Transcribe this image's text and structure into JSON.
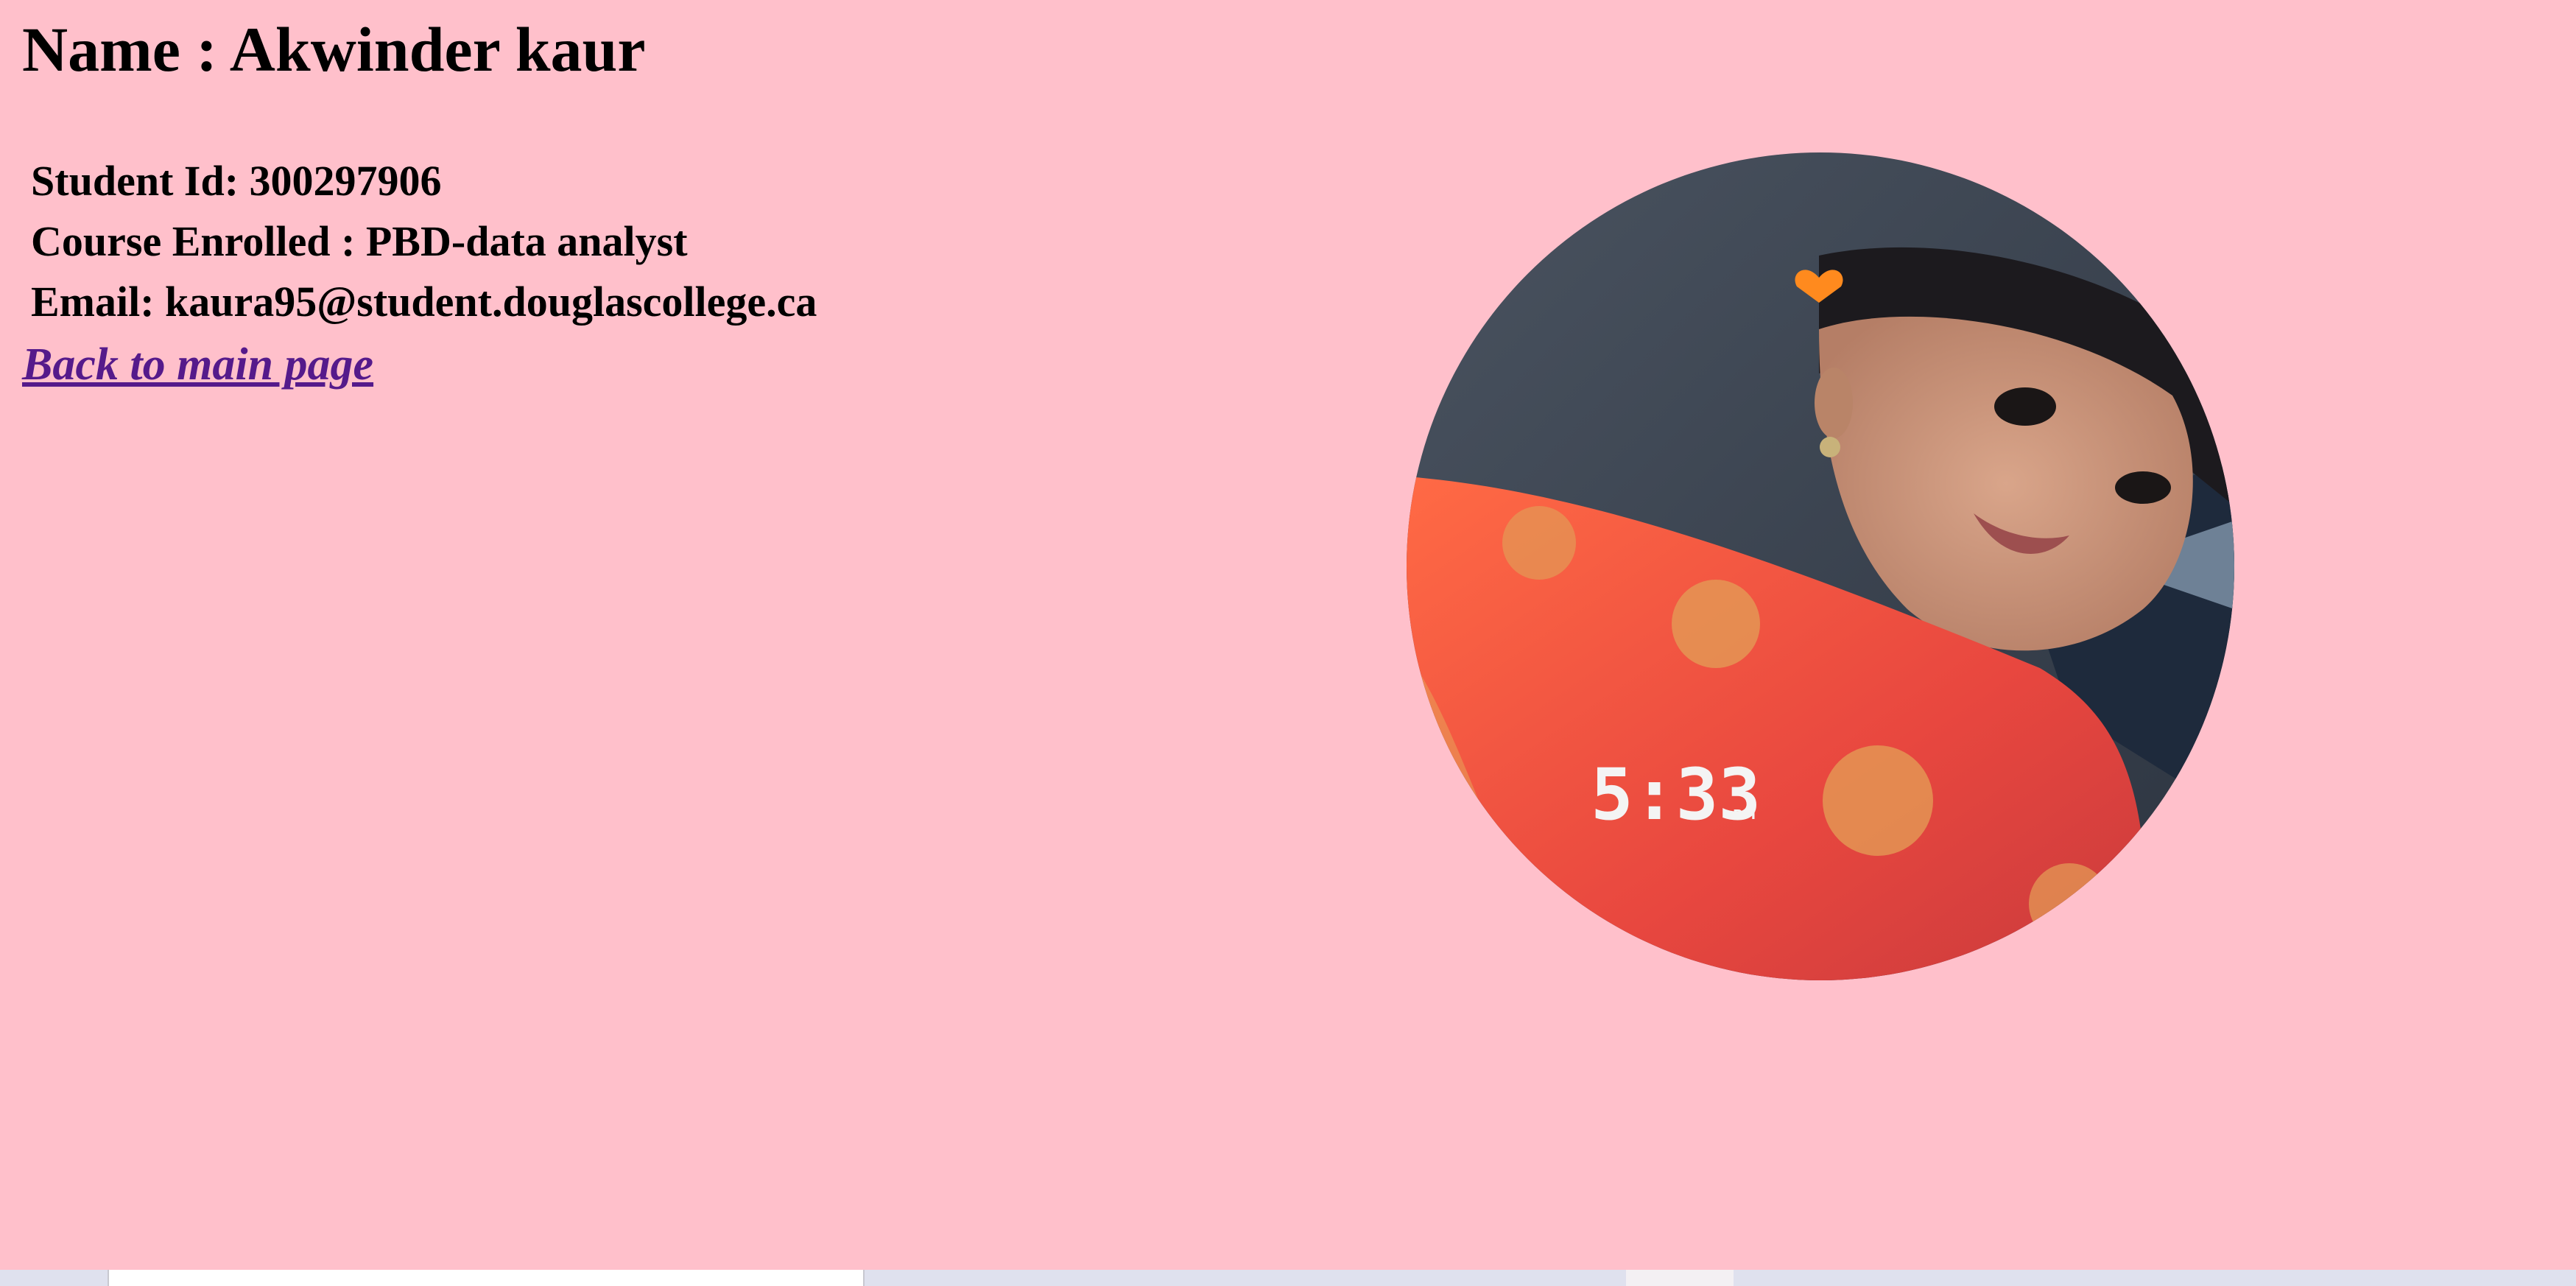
{
  "profile": {
    "name_heading": "Name : Akwinder kaur",
    "student_id": "Student Id: 300297906",
    "course": "Course Enrolled : PBD-data analyst",
    "email": "Email: kaura95@student.douglascollege.ca",
    "back_link": "Back to main page"
  },
  "photo": {
    "timestamp_overlay": "5:33",
    "timestamp_suffix": "PM"
  },
  "colors": {
    "page_background": "#ffc0cb",
    "link": "#551a8b",
    "text": "#000000"
  }
}
